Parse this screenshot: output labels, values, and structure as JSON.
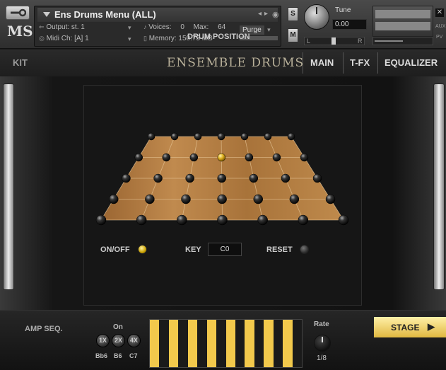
{
  "header": {
    "instrument_name": "Ens Drums Menu (ALL)",
    "output_label": "Output:",
    "output_value": "st. 1",
    "voices_label": "Voices:",
    "voices_value": "0",
    "max_label": "Max:",
    "max_value": "64",
    "purge_label": "Purge",
    "midi_label": "Midi Ch:",
    "midi_value": "[A]  1",
    "memory_label": "Memory:",
    "memory_value": "150.75 MB",
    "s_label": "S",
    "m_label": "M",
    "tune_label": "Tune",
    "tune_value": "0.00",
    "pan_l": "L",
    "pan_r": "R",
    "aux_label": "AUX",
    "pv_label": "PV",
    "logo": "MS"
  },
  "topbar": {
    "kit_label": "KIT",
    "title": "ENSEMBLE DRUMS",
    "tabs": [
      "MAIN",
      "T-FX",
      "EQUALIZER"
    ]
  },
  "drum_position": {
    "title": "DRUM POSITION",
    "on_off_label": "ON/OFF",
    "key_label": "KEY",
    "key_value": "C0",
    "reset_label": "RESET",
    "grid_rows": 5,
    "grid_cols": 7,
    "selected": {
      "row": 1,
      "col": 3
    }
  },
  "amp_seq": {
    "label": "AMP SEQ.",
    "on_label": "On",
    "rate_buttons": [
      "1X",
      "2X",
      "4X"
    ],
    "notes": [
      "Bb6",
      "B6",
      "C7"
    ],
    "steps": [
      1,
      1,
      1,
      1,
      1,
      1,
      1,
      1,
      1,
      1,
      1,
      1,
      1,
      1,
      1,
      1
    ],
    "rate_label": "Rate",
    "rate_value": "1/8",
    "stage_label": "STAGE"
  },
  "colors": {
    "accent": "#f2c94c",
    "wood": "#b07a3e"
  }
}
